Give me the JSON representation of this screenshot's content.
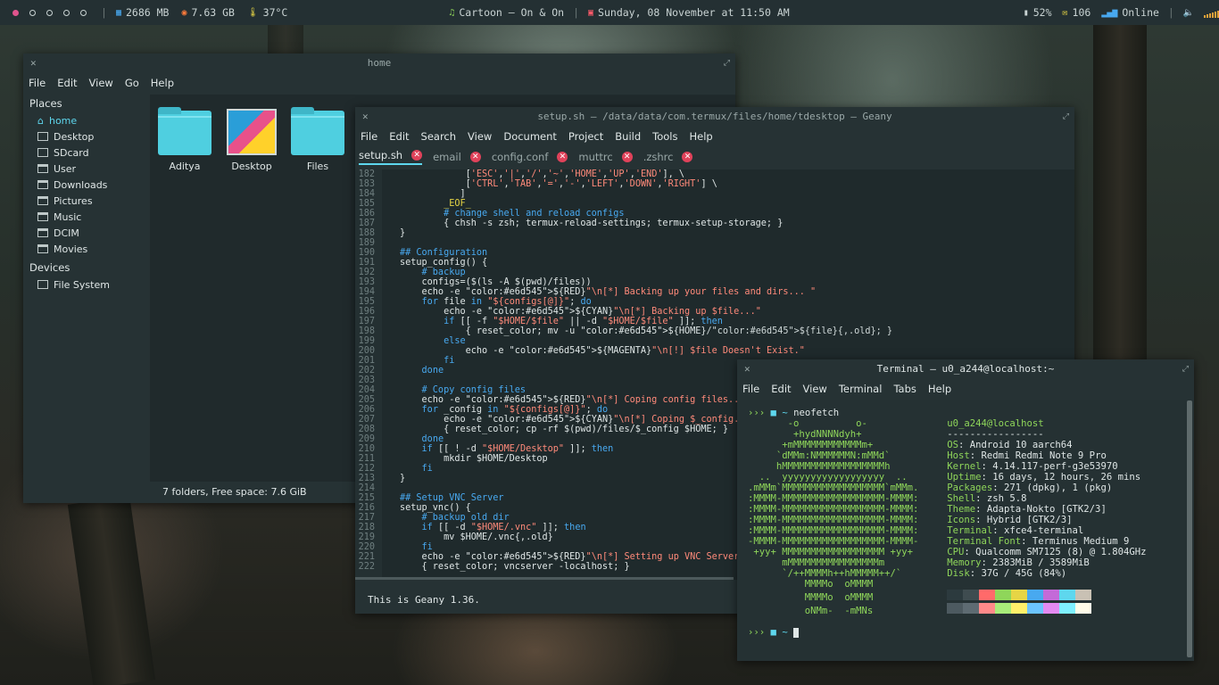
{
  "topbar": {
    "ram": "2686 MB",
    "disk": "7.63 GB",
    "temp": "37°C",
    "music": "Cartoon – On & On",
    "datetime": "Sunday, 08 November at 11:50 AM",
    "battery": "52%",
    "mail": "106",
    "network": "Online",
    "icons": {
      "workspace": "circle-icon",
      "ram": "ram-icon",
      "disk": "disk-icon",
      "temp": "thermometer-icon",
      "music": "music-note-icon",
      "calendar": "calendar-icon",
      "battery": "battery-icon",
      "mail": "mail-icon",
      "network": "network-icon",
      "volume": "volume-icon"
    }
  },
  "filemanager": {
    "title": "home",
    "menu": [
      "File",
      "Edit",
      "View",
      "Go",
      "Help"
    ],
    "places_header": "Places",
    "places": [
      "home",
      "Desktop",
      "SDcard",
      "User",
      "Downloads",
      "Pictures",
      "Music",
      "DCIM",
      "Movies"
    ],
    "devices_header": "Devices",
    "devices": [
      "File System"
    ],
    "items": [
      "Aditya",
      "Desktop",
      "Files"
    ],
    "status": "7 folders, Free space: 7.6 GiB"
  },
  "geany": {
    "title": "setup.sh – /data/data/com.termux/files/home/tdesktop – Geany",
    "menu": [
      "File",
      "Edit",
      "Search",
      "View",
      "Document",
      "Project",
      "Build",
      "Tools",
      "Help"
    ],
    "tabs": [
      "setup.sh",
      "email",
      "config.conf",
      "muttrc",
      ".zshrc"
    ],
    "message": "This is Geany 1.36.",
    "lines": [
      {
        "n": "182",
        "t": "            ['ESC','|','/','~','HOME','UP','END'], \\"
      },
      {
        "n": "183",
        "t": "            ['CTRL','TAB','=','-','LEFT','DOWN','RIGHT'] \\"
      },
      {
        "n": "184",
        "t": "           ]"
      },
      {
        "n": "185",
        "t": "        _EOF_"
      },
      {
        "n": "186",
        "t": "        # change shell and reload configs"
      },
      {
        "n": "187",
        "t": "        { chsh -s zsh; termux-reload-settings; termux-setup-storage; }"
      },
      {
        "n": "188",
        "t": "}"
      },
      {
        "n": "189",
        "t": ""
      },
      {
        "n": "190",
        "t": "## Configuration"
      },
      {
        "n": "191",
        "t": "setup_config() {"
      },
      {
        "n": "192",
        "t": "    # backup"
      },
      {
        "n": "193",
        "t": "    configs=($(ls -A $(pwd)/files))"
      },
      {
        "n": "194",
        "t": "    echo -e ${RED}\"\\n[*] Backing up your files and dirs... \""
      },
      {
        "n": "195",
        "t": "    for file in \"${configs[@]}\"; do"
      },
      {
        "n": "196",
        "t": "        echo -e ${CYAN}\"\\n[*] Backing up $file...\""
      },
      {
        "n": "197",
        "t": "        if [[ -f \"$HOME/$file\" || -d \"$HOME/$file\" ]]; then"
      },
      {
        "n": "198",
        "t": "            { reset_color; mv -u ${HOME}/${file}{,.old}; }"
      },
      {
        "n": "199",
        "t": "        else"
      },
      {
        "n": "200",
        "t": "            echo -e ${MAGENTA}\"\\n[!] $file Doesn't Exist.\""
      },
      {
        "n": "201",
        "t": "        fi"
      },
      {
        "n": "202",
        "t": "    done"
      },
      {
        "n": "203",
        "t": ""
      },
      {
        "n": "204",
        "t": "    # Copy config files"
      },
      {
        "n": "205",
        "t": "    echo -e ${RED}\"\\n[*] Coping config files... \""
      },
      {
        "n": "206",
        "t": "    for _config in \"${configs[@]}\"; do"
      },
      {
        "n": "207",
        "t": "        echo -e ${CYAN}\"\\n[*] Coping $_config...\""
      },
      {
        "n": "208",
        "t": "        { reset_color; cp -rf $(pwd)/files/$_config $HOME; }"
      },
      {
        "n": "209",
        "t": "    done"
      },
      {
        "n": "210",
        "t": "    if [[ ! -d \"$HOME/Desktop\" ]]; then"
      },
      {
        "n": "211",
        "t": "        mkdir $HOME/Desktop"
      },
      {
        "n": "212",
        "t": "    fi"
      },
      {
        "n": "213",
        "t": "}"
      },
      {
        "n": "214",
        "t": ""
      },
      {
        "n": "215",
        "t": "## Setup VNC Server"
      },
      {
        "n": "216",
        "t": "setup_vnc() {"
      },
      {
        "n": "217",
        "t": "    # backup old dir"
      },
      {
        "n": "218",
        "t": "    if [[ -d \"$HOME/.vnc\" ]]; then"
      },
      {
        "n": "219",
        "t": "        mv $HOME/.vnc{,.old}"
      },
      {
        "n": "220",
        "t": "    fi"
      },
      {
        "n": "221",
        "t": "    echo -e ${RED}\"\\n[*] Setting up VNC Server...\""
      },
      {
        "n": "222",
        "t": "    { reset_color; vncserver -localhost; }"
      }
    ]
  },
  "terminal": {
    "title": "Terminal – u0_a244@localhost:~",
    "menu": [
      "File",
      "Edit",
      "View",
      "Terminal",
      "Tabs",
      "Help"
    ],
    "prompt": "›››",
    "cwd": "~",
    "command": "neofetch",
    "ascii": [
      "       -o          o-",
      "        +hydNNNNdyh+",
      "      +mMMMMMMMMMMMMm+",
      "     `dMMm:NMMMMMMN:mMMd`",
      "     hMMMMMMMMMMMMMMMMMMh",
      "  ..  yyyyyyyyyyyyyyyyyy  ..",
      ".mMMm`MMMMMMMMMMMMMMMMMM`mMMm.",
      ":MMMM-MMMMMMMMMMMMMMMMMM-MMMM:",
      ":MMMM-MMMMMMMMMMMMMMMMMM-MMMM:",
      ":MMMM-MMMMMMMMMMMMMMMMMM-MMMM:",
      ":MMMM-MMMMMMMMMMMMMMMMMM-MMMM:",
      "-MMMM-MMMMMMMMMMMMMMMMMM-MMMM-",
      " +yy+ MMMMMMMMMMMMMMMMMM +yy+",
      "      mMMMMMMMMMMMMMMMMm",
      "      `/++MMMMh++hMMMMM++/`",
      "          MMMMo  oMMMM",
      "          MMMMo  oMMMM",
      "          oNMm-  -mMNs"
    ],
    "userhost": "u0_a244@localhost",
    "divider": "-----------------",
    "info": [
      {
        "k": "OS",
        "v": "Android 10 aarch64"
      },
      {
        "k": "Host",
        "v": "Redmi Redmi Note 9 Pro"
      },
      {
        "k": "Kernel",
        "v": "4.14.117-perf-g3e53970"
      },
      {
        "k": "Uptime",
        "v": "16 days, 12 hours, 26 mins"
      },
      {
        "k": "Packages",
        "v": "271 (dpkg), 1 (pkg)"
      },
      {
        "k": "Shell",
        "v": "zsh 5.8"
      },
      {
        "k": "Theme",
        "v": "Adapta-Nokto [GTK2/3]"
      },
      {
        "k": "Icons",
        "v": "Hybrid [GTK2/3]"
      },
      {
        "k": "Terminal",
        "v": "xfce4-terminal"
      },
      {
        "k": "Terminal Font",
        "v": "Terminus Medium 9"
      },
      {
        "k": "CPU",
        "v": "Qualcomm SM7125 (8) @ 1.804GHz"
      },
      {
        "k": "Memory",
        "v": "2383MiB / 3589MiB"
      },
      {
        "k": "Disk",
        "v": "37G / 45G (84%)"
      }
    ],
    "palette_top": [
      "#2c3a3e",
      "#3f4c50",
      "#ff6a6a",
      "#8fd65a",
      "#e6d545",
      "#48a9f0",
      "#c46ad8",
      "#5ed7ee",
      "#c9c1b4"
    ],
    "palette_bottom": [
      "#4d5a60",
      "#5e6b72",
      "#ff8a8a",
      "#a8ec7a",
      "#fff06a",
      "#6cc4ff",
      "#e48af2",
      "#7ff0ff",
      "#fffbe8"
    ]
  }
}
